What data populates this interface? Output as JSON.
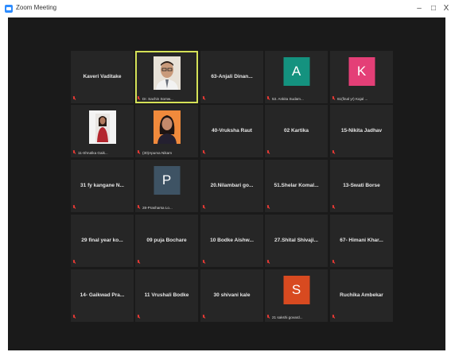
{
  "window": {
    "title": "Zoom Meeting",
    "controls": {
      "minimize": "–",
      "maximize": "□",
      "close": "X"
    }
  },
  "participants": [
    {
      "display": "Kaveri Vaditake",
      "label": "",
      "avatar_type": "name"
    },
    {
      "display": "",
      "label": "Dr. Sachin Somw...",
      "avatar_type": "photo",
      "photo": "man-with-glasses",
      "active": true
    },
    {
      "display": "63-Anjali Dinan...",
      "label": "",
      "avatar_type": "name"
    },
    {
      "display": "A",
      "label": "53. Ankita Sudam...",
      "avatar_type": "letter",
      "color": "#14927F"
    },
    {
      "display": "K",
      "label": "61(final yr) Kajal ...",
      "avatar_type": "letter",
      "color": "#E43F77"
    },
    {
      "display": "",
      "label": "11-Shrutika Gaik...",
      "avatar_type": "photo",
      "photo": "woman-red"
    },
    {
      "display": "",
      "label": "(30)Apurva Nikam",
      "avatar_type": "photo",
      "photo": "woman-orange"
    },
    {
      "display": "40-Vruksha Raut",
      "label": "",
      "avatar_type": "name"
    },
    {
      "display": "02 Kartika",
      "label": "",
      "avatar_type": "name"
    },
    {
      "display": "15-Nikita Jadhav",
      "label": "",
      "avatar_type": "name"
    },
    {
      "display": "31 fy kangane N...",
      "label": "",
      "avatar_type": "name"
    },
    {
      "display": "P",
      "label": "28-Prasharsa Lo...",
      "avatar_type": "letter",
      "color": "#3E5364"
    },
    {
      "display": "20.Nilambari go...",
      "label": "",
      "avatar_type": "name"
    },
    {
      "display": "51.Shelar Komal...",
      "label": "",
      "avatar_type": "name"
    },
    {
      "display": "13-Swati Borse",
      "label": "",
      "avatar_type": "name"
    },
    {
      "display": "29 final year ko...",
      "label": "",
      "avatar_type": "name"
    },
    {
      "display": "09 puja Bochare",
      "label": "",
      "avatar_type": "name"
    },
    {
      "display": "10 Bodke Aishw...",
      "label": "",
      "avatar_type": "name"
    },
    {
      "display": "27.Shital Shivaji...",
      "label": "",
      "avatar_type": "name"
    },
    {
      "display": "67- Himani Khar...",
      "label": "",
      "avatar_type": "name"
    },
    {
      "display": "14- Gaikwad Pra...",
      "label": "",
      "avatar_type": "name"
    },
    {
      "display": "11 Vrushali Bodke",
      "label": "",
      "avatar_type": "name"
    },
    {
      "display": "30 shivani kale",
      "label": "",
      "avatar_type": "name"
    },
    {
      "display": "S",
      "label": "21 sakshi govard...",
      "avatar_type": "letter",
      "color": "#D84A20"
    },
    {
      "display": "Ruchika Ambekar",
      "label": "",
      "avatar_type": "name"
    }
  ],
  "icons": {
    "mic_muted": "mic-muted-icon"
  },
  "colors": {
    "active_speaker_border": "#D4E157",
    "muted_mic": "#E53935",
    "tile_bg": "#262626",
    "stage_bg": "#1a1a1a"
  }
}
